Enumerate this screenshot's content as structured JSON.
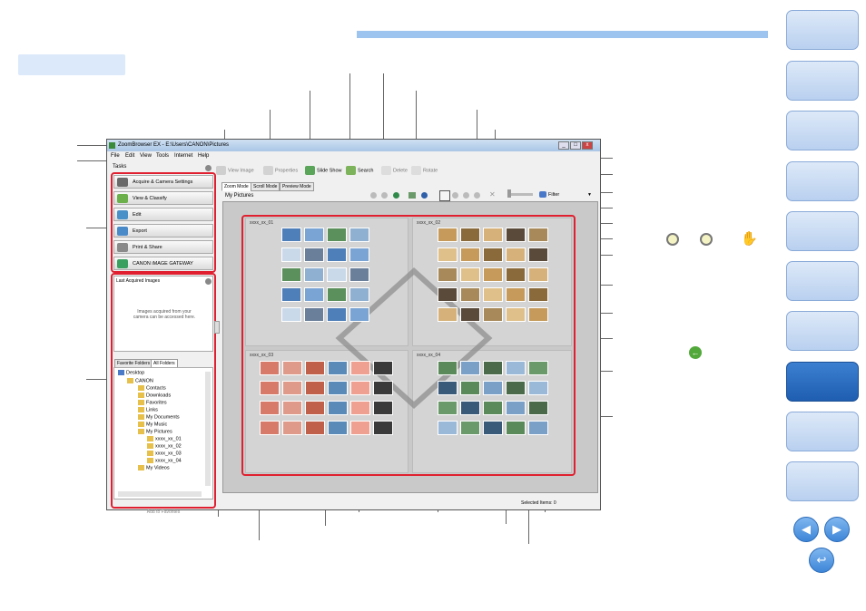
{
  "app": {
    "title": "ZoomBrowser EX  -  E:\\Users\\CANON\\Pictures",
    "menu": [
      "File",
      "Edit",
      "View",
      "Tools",
      "Internet",
      "Help"
    ]
  },
  "toolbar": {
    "view_image": "View Image",
    "properties": "Properties",
    "slide_show": "Slide Show",
    "search": "Search",
    "delete": "Delete",
    "rotate": "Rotate",
    "filter": "Filter"
  },
  "tasks": {
    "label": "Tasks",
    "items": [
      "Acquire & Camera Settings",
      "View & Classify",
      "Edit",
      "Export",
      "Print & Share",
      "CANON iMAGE GATEWAY"
    ]
  },
  "last_acquired": {
    "label": "Last Acquired Images",
    "message": "Images acquired from your camera can be accessed here."
  },
  "folder_tabs": [
    "Favorite Folders",
    "All Folders"
  ],
  "tree": [
    "Desktop",
    "CANON",
    "Contacts",
    "Downloads",
    "Favorites",
    "Links",
    "My Documents",
    "My Music",
    "My Pictures",
    "xxxx_xx_01",
    "xxxx_xx_02",
    "xxxx_xx_03",
    "xxxx_xx_04",
    "My Videos"
  ],
  "add_to_favorites": "Add to Favorites",
  "view_tabs": [
    "Zoom Mode",
    "Scroll Mode",
    "Preview Mode"
  ],
  "location": "My Pictures",
  "folders": [
    "xxxx_xx_01",
    "xxxx_xx_02",
    "xxxx_xx_03",
    "xxxx_xx_04"
  ],
  "status": "Selected Items: 0",
  "colors": {
    "accent_bar": "#9dc3ef",
    "nav_active": "#1f5eb0",
    "highlight": "#e02030"
  }
}
